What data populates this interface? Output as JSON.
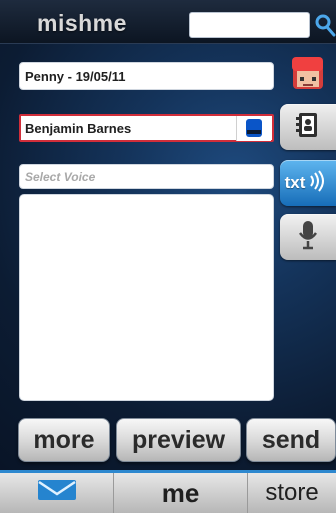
{
  "header": {
    "logo": "mishme"
  },
  "compose": {
    "title_field": "Penny - 19/05/11",
    "recipient_field": "Benjamin Barnes",
    "voice_placeholder": "Select Voice"
  },
  "sidebar": {
    "txt_label": "txt"
  },
  "actions": {
    "more": "more",
    "preview": "preview",
    "send": "send"
  },
  "tabs": {
    "me": "me",
    "store": "store"
  },
  "colors": {
    "accent_blue": "#2d88cf",
    "selection_red": "#d12e3a",
    "background": "#14335a"
  },
  "icons": {
    "search": "search-icon",
    "avatar": "avatar",
    "contacts": "contacts-icon",
    "txt": "txt-icon",
    "mic": "microphone-icon",
    "mail": "mail-icon"
  }
}
